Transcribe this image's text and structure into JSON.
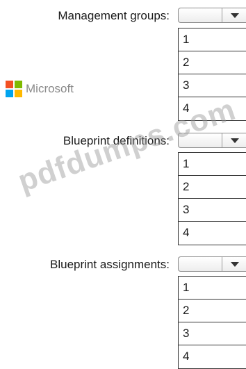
{
  "logo": {
    "text": "Microsoft",
    "colors": [
      "#f25022",
      "#7fba00",
      "#00a4ef",
      "#ffb900"
    ]
  },
  "watermark": "pdfdumps.com",
  "dropdowns": [
    {
      "label": "Management groups:",
      "selected": "",
      "options": [
        "1",
        "2",
        "3",
        "4"
      ]
    },
    {
      "label": "Blueprint definitions:",
      "selected": "",
      "options": [
        "1",
        "2",
        "3",
        "4"
      ]
    },
    {
      "label": "Blueprint assignments:",
      "selected": "",
      "options": [
        "1",
        "2",
        "3",
        "4"
      ]
    }
  ]
}
